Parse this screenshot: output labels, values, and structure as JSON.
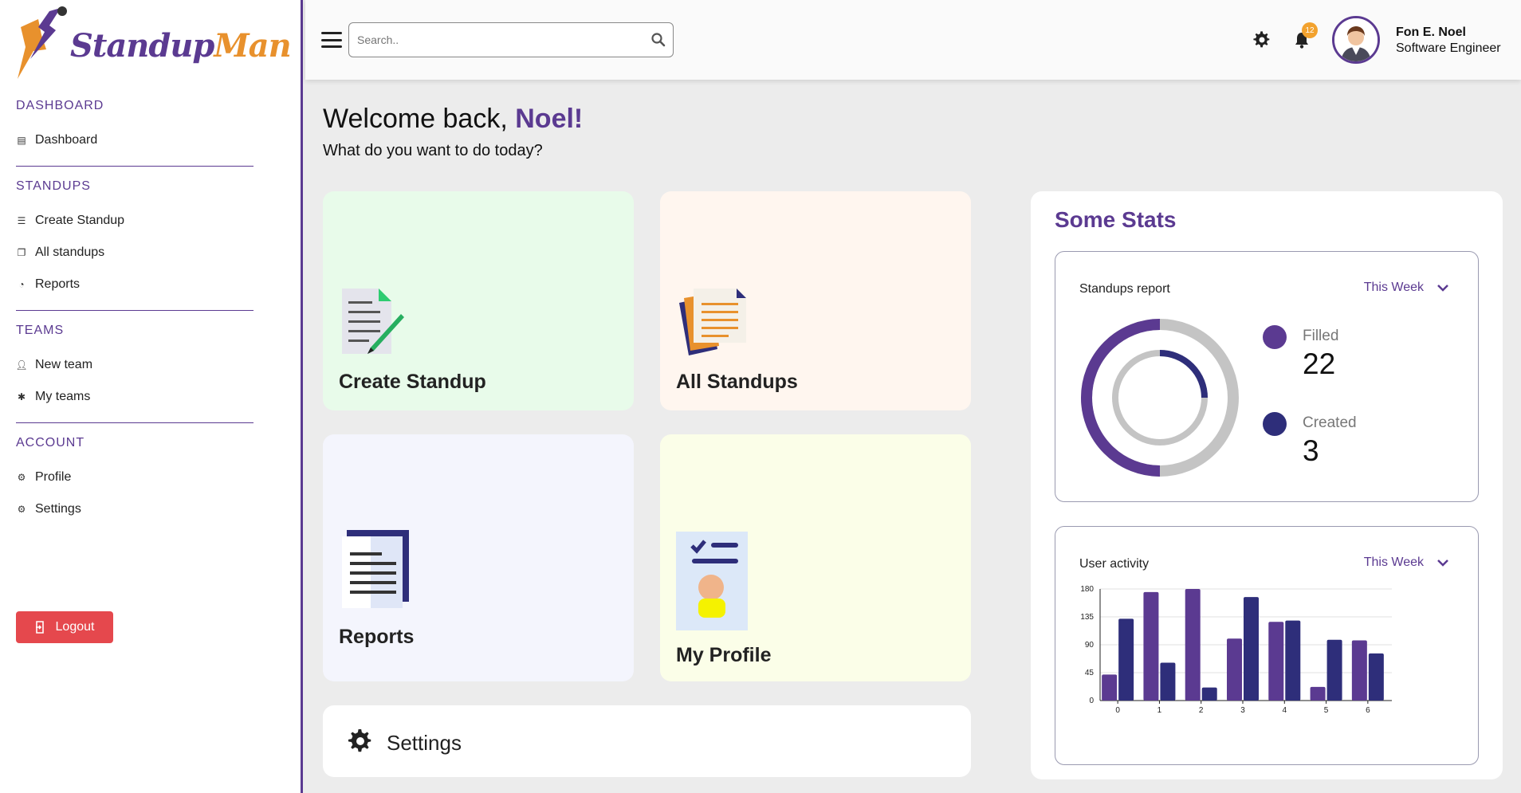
{
  "app": {
    "brand_main": "Standup",
    "brand_accent": "Man",
    "colors": {
      "primary": "#5b3a91",
      "accent": "#e8912d",
      "navy": "#2e2e7a",
      "danger": "#e5484d"
    }
  },
  "sidebar": {
    "sections": [
      {
        "title": "DASHBOARD",
        "items": [
          {
            "label": "Dashboard",
            "icon": "dashboard-icon"
          }
        ]
      },
      {
        "title": "STANDUPS",
        "items": [
          {
            "label": "Create Standup",
            "icon": "list-icon"
          },
          {
            "label": "All standups",
            "icon": "stack-icon"
          },
          {
            "label": "Reports",
            "icon": "report-icon"
          }
        ]
      },
      {
        "title": "TEAMS",
        "items": [
          {
            "label": "New team",
            "icon": "user-icon"
          },
          {
            "label": "My teams",
            "icon": "team-icon"
          }
        ]
      },
      {
        "title": "ACCOUNT",
        "items": [
          {
            "label": "Profile",
            "icon": "gear-icon"
          },
          {
            "label": "Settings",
            "icon": "gear-icon"
          }
        ]
      }
    ],
    "logout_label": "Logout"
  },
  "topbar": {
    "search_placeholder": "Search..",
    "notification_count": "12",
    "user_name": "Fon E. Noel",
    "user_role": "Software Engineer"
  },
  "main": {
    "welcome_prefix": "Welcome back, ",
    "welcome_name": "Noel!",
    "subtitle": "What do you want to do today?",
    "cards": {
      "create": "Create Standup",
      "all": "All Standups",
      "reports": "Reports",
      "profile": "My Profile",
      "settings": "Settings"
    }
  },
  "stats": {
    "title": "Some Stats",
    "standups_report": {
      "title": "Standups report",
      "period": "This Week",
      "filled_label": "Filled",
      "filled_value": "22",
      "created_label": "Created",
      "created_value": "3"
    },
    "user_activity": {
      "title": "User activity",
      "period": "This Week"
    }
  },
  "chart_data": {
    "type": "bar",
    "categories": [
      "0",
      "1",
      "2",
      "3",
      "4",
      "5",
      "6"
    ],
    "series": [
      {
        "values": [
          42,
          175,
          180,
          100,
          127,
          22,
          97
        ],
        "color": "#5b3a91"
      },
      {
        "values": [
          132,
          61,
          21,
          167,
          129,
          98,
          76
        ],
        "color": "#2e2e7a"
      }
    ],
    "yticks": [
      "0",
      "45",
      "90",
      "135",
      "180"
    ],
    "ylim": [
      0,
      180
    ],
    "grid": true
  }
}
